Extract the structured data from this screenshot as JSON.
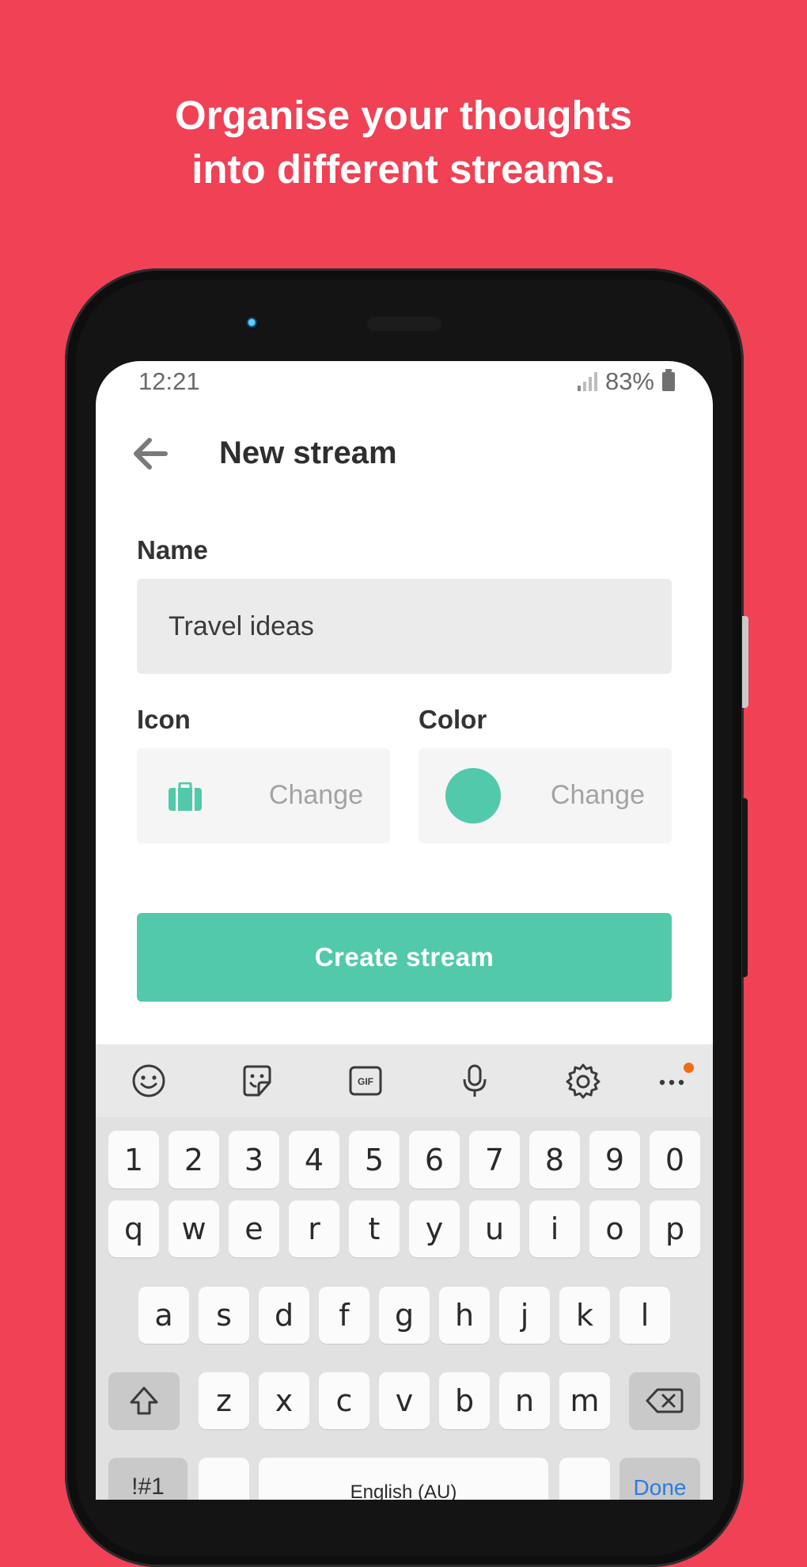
{
  "promo": {
    "headline_line1": "Organise your thoughts",
    "headline_line2": "into different streams."
  },
  "colors": {
    "background": "#f04155",
    "accent": "#52c9ab"
  },
  "status_bar": {
    "time": "12:21",
    "battery": "83%"
  },
  "app_bar": {
    "back_icon": "arrow-left-icon",
    "title": "New stream"
  },
  "form": {
    "name_label": "Name",
    "name_value": "Travel ideas",
    "icon_label": "Icon",
    "icon_name": "briefcase-icon",
    "icon_change": "Change",
    "color_label": "Color",
    "color_value": "#52c9ab",
    "color_change": "Change",
    "submit_label": "Create stream"
  },
  "keyboard": {
    "toolbar": [
      "emoji-icon",
      "sticker-icon",
      "gif-icon",
      "microphone-icon",
      "settings-icon",
      "more-icon"
    ],
    "gif_text": "GIF",
    "number_row": [
      "1",
      "2",
      "3",
      "4",
      "5",
      "6",
      "7",
      "8",
      "9",
      "0"
    ],
    "row1": [
      "q",
      "w",
      "e",
      "r",
      "t",
      "y",
      "u",
      "i",
      "o",
      "p"
    ],
    "row2": [
      "a",
      "s",
      "d",
      "f",
      "g",
      "h",
      "j",
      "k",
      "l"
    ],
    "row3": [
      "z",
      "x",
      "c",
      "v",
      "b",
      "n",
      "m"
    ],
    "symbols_label": "!#1",
    "space_label": "English (AU)",
    "done_label": "Done"
  }
}
